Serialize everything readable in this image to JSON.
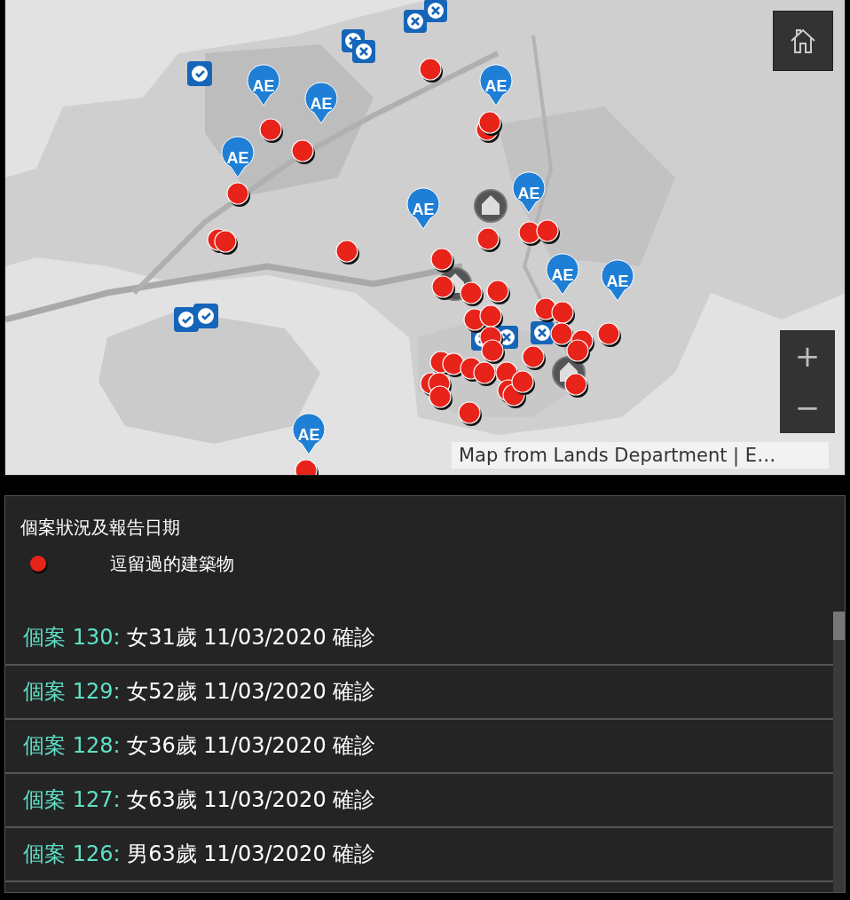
{
  "map": {
    "kind": "picture",
    "pins": [
      {
        "label": "AE"
      },
      {
        "label": "AE"
      },
      {
        "label": "AE"
      },
      {
        "label": "AE"
      },
      {
        "label": "AE"
      },
      {
        "label": "AE"
      },
      {
        "label": "AE"
      },
      {
        "label": "AE"
      },
      {
        "label": "AE"
      }
    ],
    "zoom_in": "+",
    "zoom_out": "−",
    "attribution": "Map from Lands Department | E…"
  },
  "legend": {
    "title": "個案狀況及報告日期",
    "items": [
      {
        "label": "逗留過的建築物",
        "color": "#e8231a"
      }
    ]
  },
  "cases": [
    {
      "case": "個案 130:",
      "detail": "女31歲 11/03/2020 確診"
    },
    {
      "case": "個案 129:",
      "detail": "女52歲 11/03/2020 確診"
    },
    {
      "case": "個案 128:",
      "detail": "女36歲 11/03/2020 確診"
    },
    {
      "case": "個案 127:",
      "detail": "女63歲 11/03/2020 確診"
    },
    {
      "case": "個案 126:",
      "detail": "男63歲 11/03/2020 確診"
    }
  ]
}
